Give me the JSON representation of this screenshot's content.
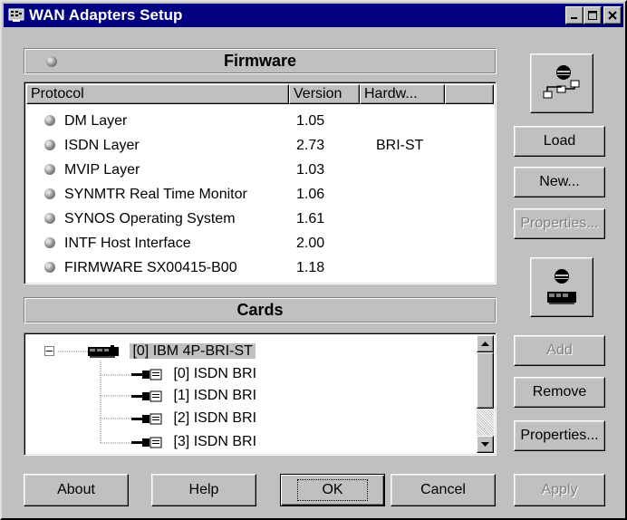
{
  "window": {
    "title": "WAN Adapters Setup"
  },
  "firmware": {
    "header": "Firmware",
    "columns": [
      "Protocol",
      "Version",
      "Hardw..."
    ],
    "rows": [
      {
        "protocol": "DM Layer",
        "version": "1.05",
        "hardware": ""
      },
      {
        "protocol": "ISDN Layer",
        "version": "2.73",
        "hardware": "BRI-ST"
      },
      {
        "protocol": "MVIP Layer",
        "version": "1.03",
        "hardware": ""
      },
      {
        "protocol": "SYNMTR Real Time Monitor",
        "version": "1.06",
        "hardware": ""
      },
      {
        "protocol": "SYNOS Operating System",
        "version": "1.61",
        "hardware": ""
      },
      {
        "protocol": "INTF Host Interface",
        "version": "2.00",
        "hardware": ""
      },
      {
        "protocol": "FIRMWARE SX00415-B00",
        "version": "1.18",
        "hardware": ""
      }
    ],
    "buttons": {
      "load": "Load",
      "new": "New...",
      "properties": "Properties..."
    }
  },
  "cards": {
    "header": "Cards",
    "tree": {
      "root": "[0] IBM 4P-BRI-ST",
      "children": [
        "[0] ISDN BRI",
        "[1] ISDN BRI",
        "[2] ISDN BRI",
        "[3] ISDN BRI"
      ]
    },
    "buttons": {
      "add": "Add",
      "remove": "Remove",
      "properties": "Properties..."
    }
  },
  "bottom_buttons": {
    "about": "About",
    "help": "Help",
    "ok": "OK",
    "cancel": "Cancel",
    "apply": "Apply"
  },
  "colors": {
    "titlebar": "#000080",
    "face": "#c0c0c0",
    "disabled_text": "#808080"
  }
}
